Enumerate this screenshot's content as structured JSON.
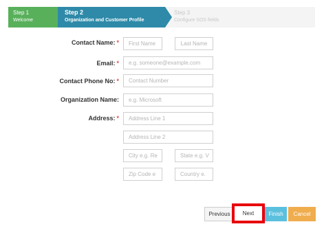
{
  "wizard": {
    "steps": [
      {
        "number": "Step 1",
        "name": "Welcome"
      },
      {
        "number": "Step 2",
        "name": "Organization and Customer Profile"
      },
      {
        "number": "Step 3",
        "name": "Configure SOS fields"
      }
    ],
    "active_step": 2
  },
  "form": {
    "contact_name": {
      "label": "Contact Name:",
      "required": "*",
      "first_placeholder": "First Name",
      "last_placeholder": "Last Name"
    },
    "email": {
      "label": "Email:",
      "required": "*",
      "placeholder": "e.g. someone@example.com"
    },
    "phone": {
      "label": "Contact Phone No:",
      "required": "*",
      "placeholder": "Contact Number"
    },
    "organization": {
      "label": "Organization Name:",
      "placeholder": "e.g. Microsoft"
    },
    "address": {
      "label": "Address:",
      "required": "*",
      "line1_placeholder": "Address Line 1",
      "line2_placeholder": "Address Line 2",
      "city_placeholder": "City e.g. Re",
      "state_placeholder": "State e.g. V",
      "zip_placeholder": "Zip Code e",
      "country_placeholder": "Country e."
    }
  },
  "buttons": {
    "previous": "Previous",
    "next": "Next",
    "finish": "Finish",
    "cancel": "Cancel"
  },
  "colors": {
    "step_done": "#58b05b",
    "step_active": "#2e8aa8",
    "highlight": "#e8000b",
    "finish": "#5bc0de",
    "cancel": "#f0ad4e"
  }
}
